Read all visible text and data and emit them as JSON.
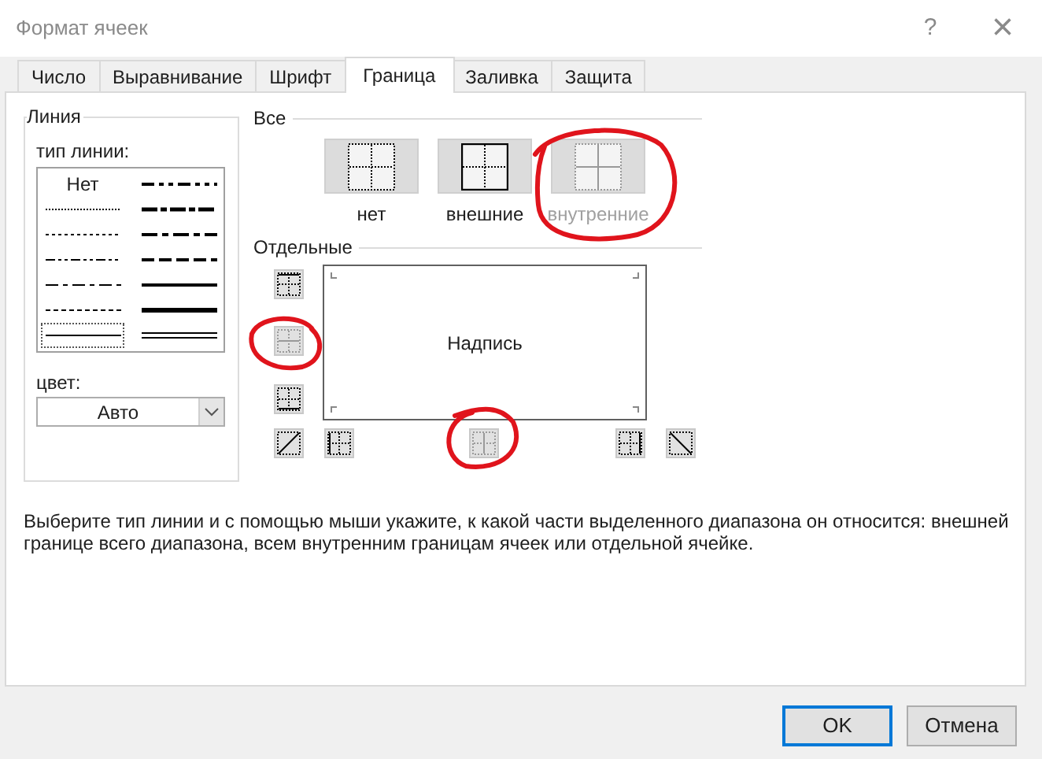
{
  "window": {
    "title": "Формат ячеек",
    "help": "?",
    "close": "×"
  },
  "tabs": [
    {
      "label": "Число",
      "selected": false
    },
    {
      "label": "Выравнивание",
      "selected": false
    },
    {
      "label": "Шрифт",
      "selected": false
    },
    {
      "label": "Граница",
      "selected": true
    },
    {
      "label": "Заливка",
      "selected": false
    },
    {
      "label": "Защита",
      "selected": false
    }
  ],
  "line": {
    "legend": "Линия",
    "style_label": "тип линии:",
    "styles": [
      {
        "kind": "none",
        "label": "Нет",
        "selected": false
      },
      {
        "kind": "hair",
        "selected": false
      },
      {
        "kind": "dotted",
        "selected": false
      },
      {
        "kind": "dash_dot_dot",
        "selected": false
      },
      {
        "kind": "dash_dot",
        "selected": false
      },
      {
        "kind": "dashed",
        "selected": false
      },
      {
        "kind": "thin",
        "selected": true
      },
      {
        "kind": "medium_dash_dot_dot",
        "selected": false
      },
      {
        "kind": "slanted_dash_dot",
        "selected": false
      },
      {
        "kind": "medium_dash_dot",
        "selected": false
      },
      {
        "kind": "medium_dashed",
        "selected": false
      },
      {
        "kind": "medium",
        "selected": false
      },
      {
        "kind": "thick",
        "selected": false
      },
      {
        "kind": "double",
        "selected": false
      }
    ],
    "color_label": "цвет:",
    "color_value": "Авто"
  },
  "presets": {
    "legend": "Все",
    "items": [
      {
        "kind": "none",
        "label": "нет",
        "disabled": false
      },
      {
        "kind": "outline",
        "label": "внешние",
        "disabled": false
      },
      {
        "kind": "inside",
        "label": "внутренние",
        "disabled": true
      }
    ]
  },
  "borders": {
    "legend": "Отдельные",
    "preview_text": "Надпись",
    "side_buttons": [
      {
        "kind": "top",
        "disabled": false
      },
      {
        "kind": "inside_horizontal",
        "disabled": true
      },
      {
        "kind": "bottom",
        "disabled": false
      },
      {
        "kind": "diagonal_up",
        "disabled": false
      }
    ],
    "bottom_buttons": [
      {
        "kind": "left",
        "disabled": false
      },
      {
        "kind": "inside_vertical",
        "disabled": true
      },
      {
        "kind": "right",
        "disabled": false
      },
      {
        "kind": "diagonal_down",
        "disabled": false
      }
    ]
  },
  "hint": "Выберите тип линии и с помощью мыши укажите, к какой части выделенного диапазона он относится: внешней границе всего диапазона, всем внутренним границам ячеек или отдельной ячейке.",
  "buttons": [
    {
      "label": "OK",
      "default": true
    },
    {
      "label": "Отмена",
      "default": false
    }
  ]
}
